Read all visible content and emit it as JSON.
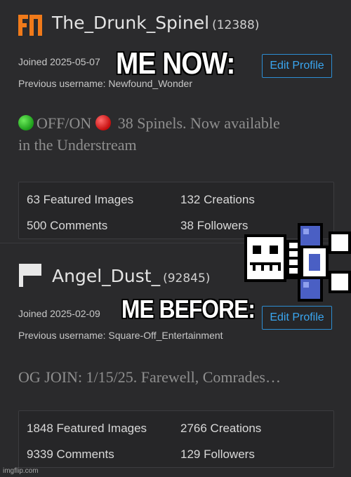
{
  "profiles": [
    {
      "username": "The_Drunk_Spinel",
      "points": "(12388)",
      "joined": "Joined 2025-05-07",
      "previous": "Previous username: Newfound_Wonder",
      "edit_label": "Edit Profile",
      "bio_status": "OFF/ON",
      "bio_rest_line1": "38 Spinels. Now available",
      "bio_line2": "in the Understream",
      "stats": {
        "featured": "63 Featured Images",
        "creations": "132 Creations",
        "comments": "500 Comments",
        "followers": "38 Followers"
      },
      "avatar_icon": "orange-logo-icon",
      "accent": "#f07a1a"
    },
    {
      "username": "Angel_Dust_",
      "points": "(92845)",
      "joined": "Joined 2025-02-09",
      "previous": "Previous username: Square-Off_Entertainment",
      "edit_label": "Edit Profile",
      "bio_line1": "OG JOIN: 1/15/25. Farewell, Comrades…",
      "stats": {
        "featured": "1848 Featured Images",
        "creations": "2766 Creations",
        "comments": "9339 Comments",
        "followers": "129 Followers"
      },
      "avatar_icon": "white-flag-icon"
    }
  ],
  "captions": {
    "top": "ME NOW:",
    "bottom": "ME BEFORE:"
  },
  "watermark": "imgflip.com",
  "sprite_icon": "pixel-skeleton-sprite-icon",
  "colors": {
    "background": "#2b2b2d",
    "link_blue": "#3aa6f0",
    "green_dot": "#2fbf24",
    "red_dot": "#e01818"
  }
}
